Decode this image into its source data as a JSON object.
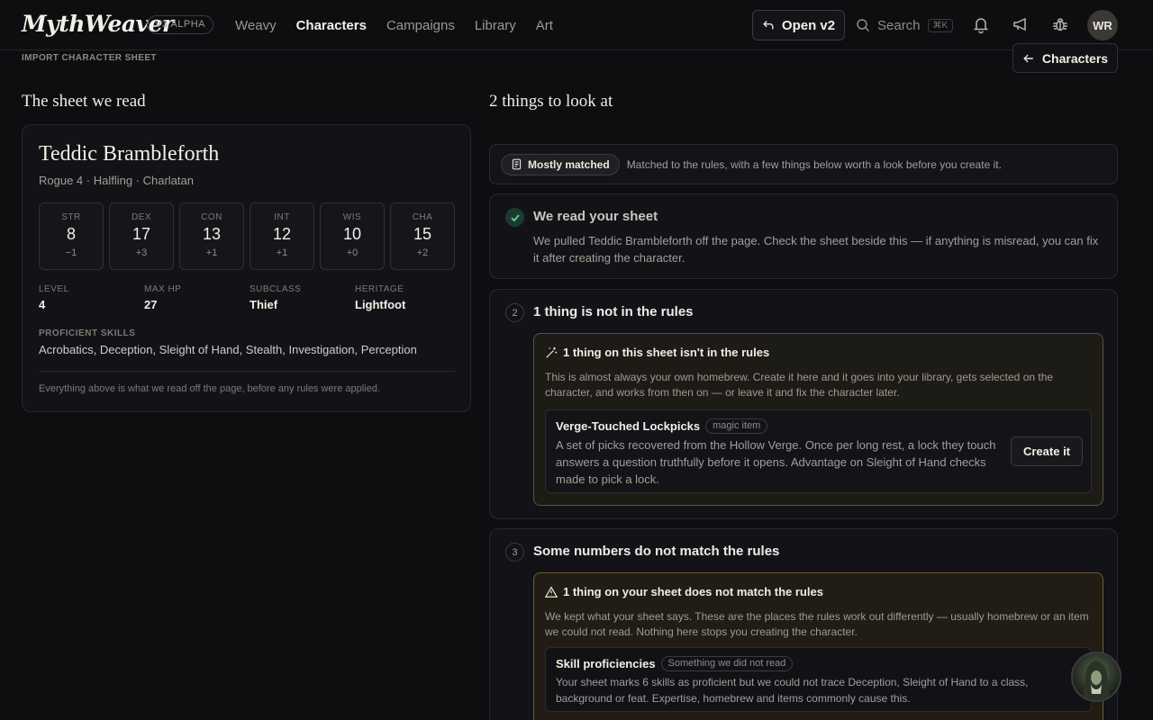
{
  "app": {
    "logo": "MythWeaver",
    "version_badge": "V3 ALPHA"
  },
  "nav": {
    "items": [
      "Weavy",
      "Characters",
      "Campaigns",
      "Library",
      "Art"
    ],
    "active": "Characters"
  },
  "header": {
    "open_v2_label": "Open v2",
    "search_label": "Search",
    "search_shortcut": "⌘K",
    "avatar_initials": "WR"
  },
  "page": {
    "breadcrumb": "IMPORT CHARACTER SHEET",
    "back_label": "Characters",
    "left_heading": "The sheet we read",
    "right_heading": "2 things to look at"
  },
  "sheet": {
    "name": "Teddic Brambleforth",
    "subtitle": "Rogue 4 · Halfling · Charlatan",
    "abilities": [
      {
        "abbr": "STR",
        "score": "8",
        "mod": "−1"
      },
      {
        "abbr": "DEX",
        "score": "17",
        "mod": "+3"
      },
      {
        "abbr": "CON",
        "score": "13",
        "mod": "+1"
      },
      {
        "abbr": "INT",
        "score": "12",
        "mod": "+1"
      },
      {
        "abbr": "WIS",
        "score": "10",
        "mod": "+0"
      },
      {
        "abbr": "CHA",
        "score": "15",
        "mod": "+2"
      }
    ],
    "fields": [
      {
        "label": "LEVEL",
        "value": "4"
      },
      {
        "label": "MAX HP",
        "value": "27"
      },
      {
        "label": "SUBCLASS",
        "value": "Thief"
      },
      {
        "label": "HERITAGE",
        "value": "Lightfoot"
      }
    ],
    "skills_label": "PROFICIENT SKILLS",
    "skills_value": "Acrobatics, Deception, Sleight of Hand, Stealth, Investigation, Perception",
    "note": "Everything above is what we read off the page, before any rules were applied."
  },
  "match": {
    "pill": "Mostly matched",
    "text": "Matched to the rules, with a few things below worth a look before you create it."
  },
  "card1": {
    "title": "We read your sheet",
    "body": "We pulled Teddic Brambleforth off the page. Check the sheet beside this — if anything is misread, you can fix it after creating the character."
  },
  "card2": {
    "number": "2",
    "title": "1 thing is not in the rules",
    "inner_title": "1 thing on this sheet isn't in the rules",
    "inner_body": "This is almost always your own homebrew. Create it here and it goes into your library, gets selected on the character, and works from then on — or leave it and fix the character later.",
    "item_name": "Verge-Touched Lockpicks",
    "item_tag": "magic item",
    "item_desc": "A set of picks recovered from the Hollow Verge. Once per long rest, a lock they touch answers a question truthfully before it opens. Advantage on Sleight of Hand checks made to pick a lock.",
    "create_label": "Create it"
  },
  "card3": {
    "number": "3",
    "title": "Some numbers do not match the rules",
    "inner_title": "1 thing on your sheet does not match the rules",
    "inner_body": "We kept what your sheet says. These are the places the rules work out differently — usually homebrew or an item we could not read. Nothing here stops you creating the character.",
    "item_name": "Skill proficiencies",
    "item_tag": "Something we did not read",
    "item_desc": "Your sheet marks 6 skills as proficient but we could not trace Deception, Sleight of Hand to a class, background or feat. Expertise, homebrew and items commonly cause this."
  }
}
